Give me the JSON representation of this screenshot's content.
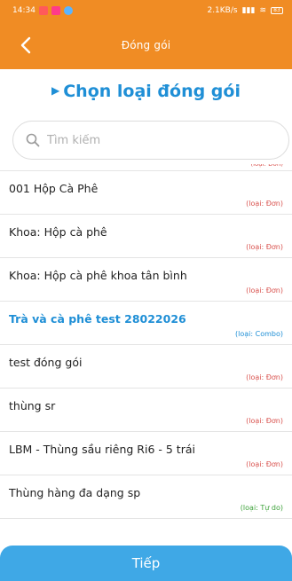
{
  "status_bar": {
    "time": "14:34",
    "speed": "2.1KB/s",
    "battery": "83"
  },
  "app_bar": {
    "title": "Đóng gói",
    "back_icon": "chevron-left-icon"
  },
  "heading": {
    "title": "Chọn loại đóng gói"
  },
  "search": {
    "placeholder": "Tìm kiếm",
    "icon": "search-icon"
  },
  "list": {
    "partial_type": "(loại: Đơn)",
    "items": [
      {
        "name": "001 Hộp Cà Phê",
        "type": "(loại: Đơn)",
        "kind": "single"
      },
      {
        "name": "Khoa: Hộp cà phê",
        "type": "(loại: Đơn)",
        "kind": "single"
      },
      {
        "name": "Khoa: Hộp cà phê khoa tân bình",
        "type": "(loại: Đơn)",
        "kind": "single"
      },
      {
        "name": "Trà và cà phê test 28022026",
        "type": "(loại: Combo)",
        "kind": "combo"
      },
      {
        "name": "test đóng gói",
        "type": "(loại: Đơn)",
        "kind": "single"
      },
      {
        "name": "thùng sr",
        "type": "(loại: Đơn)",
        "kind": "single"
      },
      {
        "name": "LBM - Thùng sầu riêng Ri6 - 5 trái",
        "type": "(loại: Đơn)",
        "kind": "single"
      },
      {
        "name": "Thùng hàng đa dạng sp",
        "type": "(loại: Tự do)",
        "kind": "free"
      }
    ]
  },
  "footer": {
    "next_label": "Tiếp"
  },
  "colors": {
    "accent": "#f08c24",
    "primary_blue": "#1f8fd6",
    "button_blue": "#3fa8e6",
    "type_red": "#d9534f",
    "type_green": "#3da23a"
  }
}
